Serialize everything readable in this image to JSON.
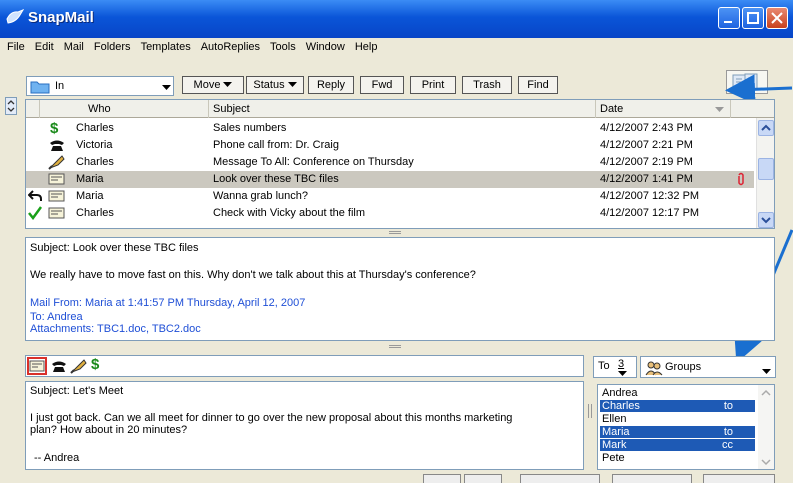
{
  "window": {
    "title": "SnapMail"
  },
  "menu": [
    "File",
    "Edit",
    "Mail",
    "Folders",
    "Templates",
    "AutoReplies",
    "Tools",
    "Window",
    "Help"
  ],
  "toolbar": {
    "folder": "In",
    "move": "Move",
    "status": "Status",
    "reply": "Reply",
    "fwd": "Fwd",
    "print": "Print",
    "trash": "Trash",
    "find": "Find"
  },
  "columns": {
    "who": "Who",
    "subject": "Subject",
    "date": "Date"
  },
  "messages": [
    {
      "status_icon": "dollar-icon",
      "who": "Charles",
      "subject": "Sales numbers",
      "date": "4/12/2007 2:43 PM"
    },
    {
      "status_icon": "phone-icon",
      "who": "Victoria",
      "subject": "Phone call from: Dr. Craig",
      "date": "4/12/2007 2:21 PM"
    },
    {
      "status_icon": "megaphone-icon",
      "who": "Charles",
      "subject": "Message To All: Conference on Thursday",
      "date": "4/12/2007 2:19 PM"
    },
    {
      "status_icon": "envelope-icon",
      "who": "Maria",
      "subject": "Look over these TBC files",
      "date": "4/12/2007 1:41 PM",
      "attachment": true,
      "selected": true
    },
    {
      "status_icon": "envelope-icon",
      "who": "Maria",
      "subject": "Wanna grab lunch?",
      "date": "4/12/2007 12:32 PM",
      "replied": true
    },
    {
      "status_icon": "envelope-icon",
      "who": "Charles",
      "subject": "Check with Vicky about the film",
      "date": "4/12/2007 12:17 PM",
      "done": true
    }
  ],
  "preview": {
    "subject": "Subject: Look over these TBC files",
    "body": "We really have to move fast on this.  Why don't we talk about this at Thursday's conference?",
    "from": "Mail From: Maria at 1:41:57 PM Thursday, April 12, 2007",
    "to": "To: Andrea",
    "attachments": "Attachments:  TBC1.doc, TBC2.doc"
  },
  "compose": {
    "subject": "Subject: Let's Meet",
    "body_line1": "I just got back. Can we all meet for dinner to go over the new proposal about this months marketing",
    "body_line2": "plan? How about in 20 minutes?",
    "signature": "-- Andrea",
    "to_label": "To",
    "to_count": "3",
    "groups_label": "Groups"
  },
  "recipients": [
    {
      "name": "Andrea",
      "tag": "",
      "selected": false
    },
    {
      "name": "Charles",
      "tag": "to",
      "selected": true
    },
    {
      "name": "Ellen",
      "tag": "",
      "selected": false
    },
    {
      "name": "Maria",
      "tag": "to",
      "selected": true
    },
    {
      "name": "Mark",
      "tag": "cc",
      "selected": true
    },
    {
      "name": "Pete",
      "tag": "",
      "selected": false
    }
  ],
  "colors": {
    "titlebar": "#0a55d8",
    "selection": "#1e5ab5",
    "annotation_arrow": "#1a6fd0"
  }
}
